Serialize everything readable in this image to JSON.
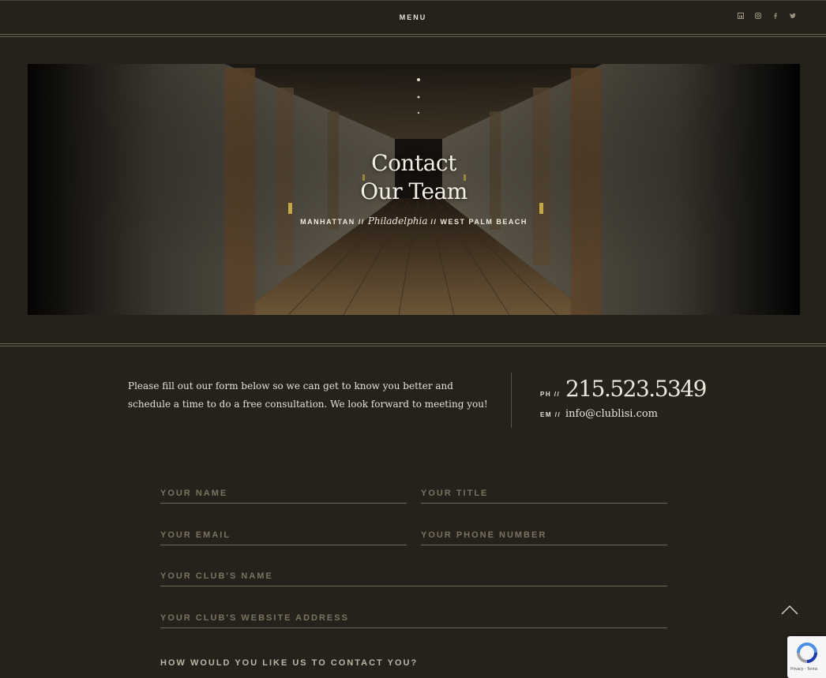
{
  "header": {
    "menu_label": "MENU",
    "social": [
      "linkedin-icon",
      "instagram-icon",
      "facebook-icon",
      "twitter-icon"
    ]
  },
  "hero": {
    "title_line1": "Contact",
    "title_line2": "Our Team",
    "loc1": "MANHATTAN",
    "sep1": " // ",
    "loc2": "Philadelphia",
    "sep2": " // ",
    "loc3": "WEST PALM BEACH"
  },
  "intro": {
    "text": "Please fill out our form below so we can get to know you better and schedule a time to do a free consultation. We look forward to meeting you!"
  },
  "contact": {
    "phone_label": "PH //",
    "phone": "215.523.5349",
    "email_label": "EM //",
    "email": "info@clublisi.com"
  },
  "form": {
    "name": "YOUR NAME",
    "title": "YOUR TITLE",
    "email": "YOUR EMAIL",
    "phone": "YOUR PHONE NUMBER",
    "club": "YOUR CLUB'S NAME",
    "website": "YOUR CLUB'S WEBSITE ADDRESS",
    "question": "HOW WOULD YOU LIKE US TO CONTACT YOU?"
  },
  "recaptcha": {
    "terms": "Privacy - Terms"
  },
  "colors": {
    "background": "#25221c",
    "text": "#e8e2d6",
    "field_label": "#7b725f"
  }
}
